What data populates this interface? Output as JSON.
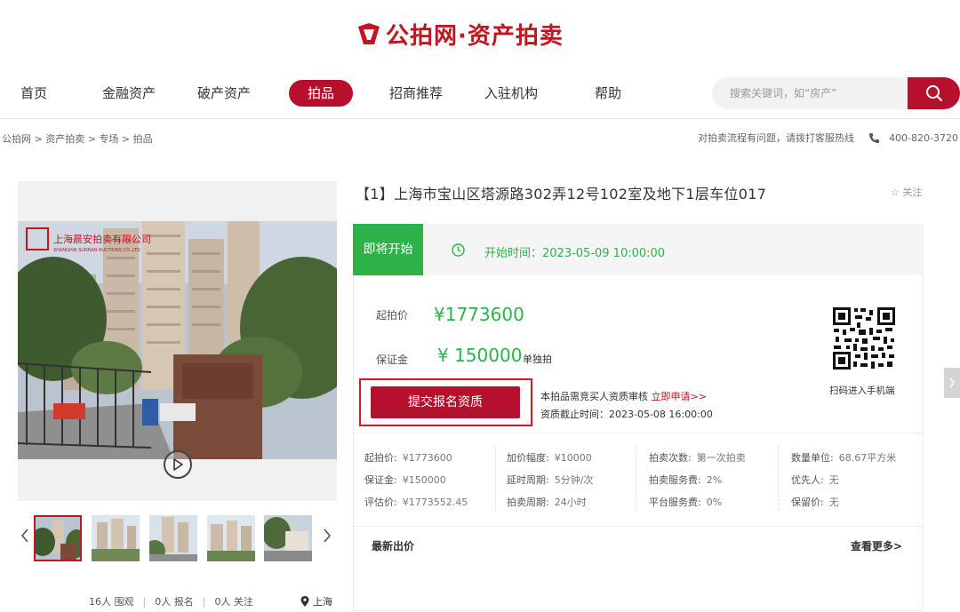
{
  "header": {
    "logo_text": "公拍网·资产拍卖",
    "brand_color": "#c4141f"
  },
  "nav": {
    "items": [
      {
        "label": "首页",
        "active": false
      },
      {
        "label": "金融资产",
        "active": false
      },
      {
        "label": "破产资产",
        "active": false
      },
      {
        "label": "拍品",
        "active": true
      },
      {
        "label": "招商推荐",
        "active": false
      },
      {
        "label": "入驻机构",
        "active": false
      },
      {
        "label": "帮助",
        "active": false
      }
    ],
    "active_color": "#b6102c"
  },
  "search": {
    "placeholder": "搜索关键词，如“房产”",
    "icon": "search-icon"
  },
  "breadcrumb": {
    "text": "公拍网 > 资产拍卖 > 专场 > 拍品"
  },
  "hotline": {
    "text": "对拍卖流程有问题，请拨打客服热线",
    "number": "400-820-3720",
    "icon": "phone-icon"
  },
  "gallery": {
    "watermark": "上海晨安拍卖有限公司",
    "watermark_en": "SHANGHAI SUNRAN AUCTIONS CO.,LTD",
    "play_icon": "play-icon",
    "thumbnails": 5,
    "selected_thumbnail": 1,
    "prev_icon": "chevron-left-icon",
    "next_icon": "chevron-right-icon"
  },
  "stats": {
    "views": "16人 围观",
    "signups": "0人 报名",
    "follows": "0人 关注",
    "location": "上海"
  },
  "lot": {
    "title": "【1】上海市宝山区塔源路302弄12号102室及地下1层车位017",
    "follow_label": "☆ 关注"
  },
  "status": {
    "tag": "即将开始",
    "start_time": "开始时间：2023-05-09 10:00:00",
    "tag_color": "#2bb34a"
  },
  "price": {
    "start_label": "起拍价",
    "start_value": "¥1773600",
    "deposit_label": "保证金",
    "deposit_value": "¥ 150000",
    "deposit_note": "单独拍",
    "qr_caption": "扫码进入手机端"
  },
  "signup": {
    "button_label": "提交报名资质",
    "note_prefix": "本拍品需竞买人资质审核",
    "note_link": "立即申请>>",
    "deadline": "资质截止时间：2023-05-08 16:00:00"
  },
  "details": {
    "col1": [
      {
        "k": "起拍价:",
        "v": "¥1773600"
      },
      {
        "k": "保证金:",
        "v": "¥150000"
      },
      {
        "k": "评估价:",
        "v": "¥1773552.45"
      }
    ],
    "col2": [
      {
        "k": "加价幅度:",
        "v": "¥10000"
      },
      {
        "k": "延时周期:",
        "v": "5分钟/次"
      },
      {
        "k": "拍卖周期:",
        "v": "24小时"
      }
    ],
    "col3": [
      {
        "k": "拍卖次数:",
        "v": "第一次拍卖"
      },
      {
        "k": "拍卖服务费:",
        "v": "2%"
      },
      {
        "k": "平台服务费:",
        "v": "0%"
      }
    ],
    "col4": [
      {
        "k": "数量单位:",
        "v": "68.67平方米"
      },
      {
        "k": "优先人:",
        "v": "无"
      },
      {
        "k": "保留价:",
        "v": "无"
      }
    ]
  },
  "bids": {
    "latest_label": "最新出价",
    "more_label": "查看更多>"
  }
}
